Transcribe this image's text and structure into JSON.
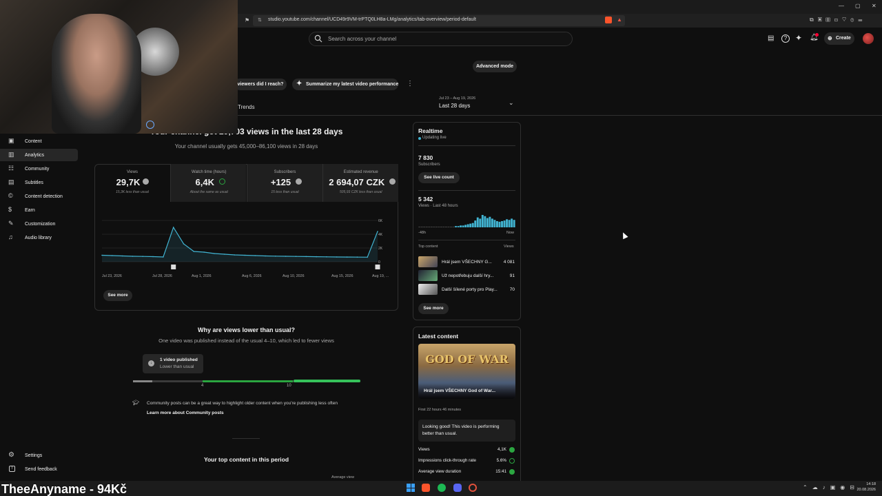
{
  "browser": {
    "url": "studio.youtube.com/channel/UCD49r9VM-trPTQ0LH8a-LMg/analytics/tab-overview/period-default",
    "window_controls": [
      "minimize-icon",
      "maximize-icon",
      "close-icon"
    ]
  },
  "header": {
    "search_placeholder": "Search across your channel",
    "create_label": "Create"
  },
  "toolbar": {
    "advanced_mode": "Advanced mode",
    "chip_viewers": "viewers did I reach?",
    "chip_summarize": "Summarize my latest video performance",
    "trends": "Trends",
    "date_range": "Jul 23 – Aug 19, 2026",
    "period": "Last 28 days"
  },
  "sidebar": {
    "items": [
      {
        "label": "Content",
        "icon": "content-icon"
      },
      {
        "label": "Analytics",
        "icon": "analytics-icon",
        "active": true
      },
      {
        "label": "Community",
        "icon": "community-icon"
      },
      {
        "label": "Subtitles",
        "icon": "subtitles-icon"
      },
      {
        "label": "Content detection",
        "icon": "content-detection-icon"
      },
      {
        "label": "Earn",
        "icon": "earn-icon"
      },
      {
        "label": "Customization",
        "icon": "customization-icon"
      },
      {
        "label": "Audio library",
        "icon": "audio-library-icon"
      }
    ],
    "settings": "Settings",
    "send_feedback": "Send feedback"
  },
  "overview": {
    "headline": "Your channel got 29,703 views in the last 28 days",
    "headline_visible": "Your channel got 29,703 views in the last 28 days",
    "subline": "Your channel usually gets 45,000–86,100 views in 28 days",
    "metrics": [
      {
        "label": "Views",
        "value": "29,7K",
        "sub": "15,3K less than usual",
        "status": "neutral"
      },
      {
        "label": "Watch time (hours)",
        "value": "6,4K",
        "sub": "About the same as usual",
        "status": "ok"
      },
      {
        "label": "Subscribers",
        "value": "+125",
        "sub": "15 less than usual",
        "status": "neutral"
      },
      {
        "label": "Estimated revenue",
        "value": "2 694,07 CZK",
        "sub": "505,93 CZK less than usual",
        "status": "neutral"
      }
    ],
    "see_more": "See more"
  },
  "chart_data": {
    "type": "line",
    "x": [
      "Jul 23, 2026",
      "Jul 28, 2026",
      "Aug 1, 2026",
      "Aug 6, 2026",
      "Aug 10, 2026",
      "Aug 15, 2026",
      "Aug 19, ..."
    ],
    "y_ticks": [
      "6K",
      "4K",
      "2K",
      "0"
    ],
    "ylim": [
      0,
      6000
    ],
    "series": [
      {
        "values": [
          950,
          900,
          850,
          800,
          780,
          750,
          700,
          5000,
          2600,
          1500,
          1400,
          1200,
          1100,
          1000,
          950,
          900,
          850,
          820,
          800,
          780,
          760,
          740,
          720,
          700,
          690,
          680,
          670,
          4400
        ]
      }
    ]
  },
  "lower_card": {
    "title": "Why are views lower than usual?",
    "desc": "One video was published instead of the usual 4–10, which led to fewer views",
    "badge_title": "1 video published",
    "badge_sub": "Lower than usual",
    "bar_labels": [
      "4",
      "10"
    ],
    "tip": "Community posts can be a great way to highlight older content when you're publishing less often",
    "tip_link": "Learn more about Community posts",
    "top_content": "Your top content in this period",
    "avg_view": "Average view"
  },
  "realtime": {
    "title": "Realtime",
    "updating": "Updating live",
    "subs_value": "7 830",
    "subs_label": "Subscribers",
    "live_btn": "See live count",
    "views_value": "5 342",
    "views_label": "Views · Last 48 hours",
    "axis_left": "-48h",
    "axis_right": "Now",
    "top_content": "Top content",
    "views_col": "Views",
    "rows": [
      {
        "title": "Hrál jsem VŠECHNY G...",
        "views": "4 081"
      },
      {
        "title": "Už nepotřebuju další hry...",
        "views": "91"
      },
      {
        "title": "Další šílené porty pro Play...",
        "views": "70"
      }
    ],
    "see_more": "See more",
    "bars": [
      0.05,
      0.05,
      0.05,
      0.05,
      0.05,
      0.05,
      0.05,
      0.05,
      0.05,
      0.05,
      0.05,
      0.05,
      0.05,
      0.05,
      0.05,
      0.1,
      0.1,
      0.15,
      0.15,
      0.2,
      0.25,
      0.3,
      0.35,
      0.55,
      0.8,
      0.7,
      1.0,
      0.9,
      0.75,
      0.85,
      0.7,
      0.6,
      0.5,
      0.45,
      0.5,
      0.55,
      0.65,
      0.6,
      0.7,
      0.6
    ]
  },
  "latest": {
    "title": "Latest content",
    "thumb_text": "GOD OF WAR",
    "video_title": "Hrál jsem VŠECHNY God of War...",
    "age": "First 22 hours 46 minutes",
    "status": "Looking good! This video is performing better than usual.",
    "stats": [
      {
        "label": "Views",
        "value": "4,1K"
      },
      {
        "label": "Impressions click-through rate",
        "value": "5.6%"
      },
      {
        "label": "Average view duration",
        "value": "15:41"
      }
    ]
  },
  "taskbar": {
    "streamer": "TheeAnyname - 94Kč",
    "time": "14:18",
    "date": "20.08.2026"
  },
  "colors": {
    "bg": "#0f0f0f",
    "accent_green": "#2ba640",
    "chart_line": "#41b4d2",
    "brand_red": "#ff0033"
  }
}
